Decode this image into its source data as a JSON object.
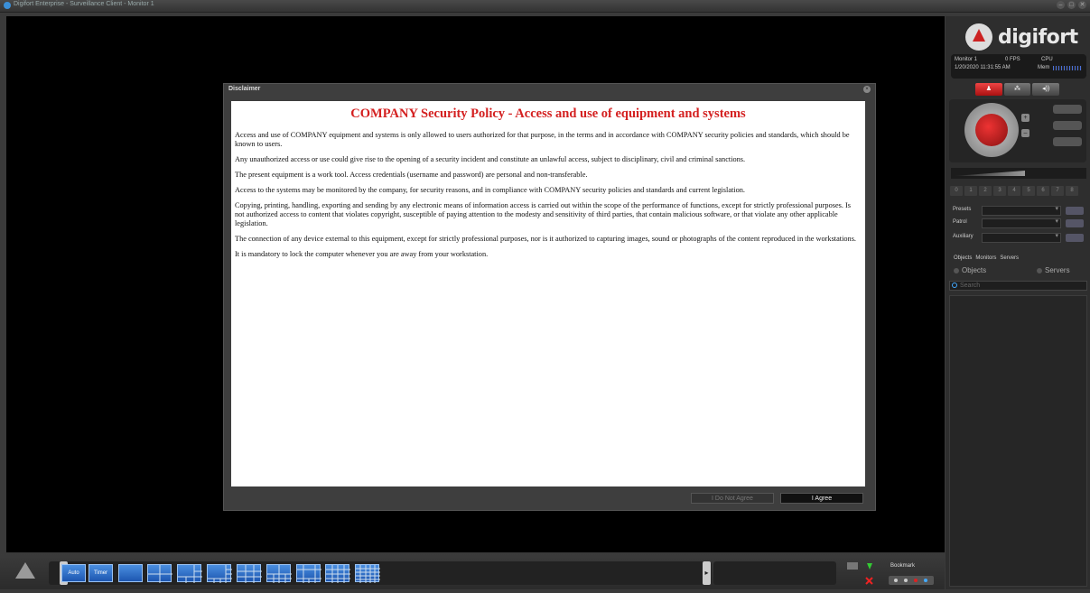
{
  "window": {
    "title": "Digifort Enterprise - Surveillance Client - Monitor 1",
    "controls": [
      "–",
      "□",
      "✕"
    ]
  },
  "right_panel": {
    "logo_text": "digifort",
    "monitor": "Monitor 1",
    "fps": "0 FPS",
    "cpu_label": "CPU",
    "datetime": "1/20/2020 11:31:55 AM",
    "mem_label": "Mem",
    "preset_numbers": [
      "0",
      "1",
      "2",
      "3",
      "4",
      "5",
      "6",
      "7",
      "8"
    ],
    "presets_label": "Presets",
    "patrol_label": "Patrol",
    "auxiliary_label": "Auxiliary",
    "tabs": [
      "Objects",
      "Monitors",
      "Servers"
    ],
    "radio_objects": "Objects",
    "radio_servers": "Servers",
    "search_placeholder": "Search"
  },
  "bottom_bar": {
    "auto_label": "Auto",
    "timer_label": "Timer",
    "bookmark_label": "Bookmark"
  },
  "dialog": {
    "title": "Disclaimer",
    "heading": "COMPANY Security Policy - Access and use of equipment and systems",
    "paragraphs": [
      "Access and use of COMPANY equipment and systems is only allowed to users authorized for that purpose, in the terms and in accordance with COMPANY security policies and standards, which should be known to users.",
      "Any unauthorized access or use could give rise to the opening of a security incident and constitute an unlawful access, subject to disciplinary, civil and criminal sanctions.",
      "The present equipment is a work tool. Access credentials (username and password) are personal and non-transferable.",
      "Access to the systems may be monitored by the company, for security reasons, and in compliance with COMPANY security policies and standards and current legislation.",
      "Copying, printing, handling, exporting and sending by any electronic means of information access is carried out within the scope of the performance of functions, except for strictly professional purposes. Is not authorized access to content that violates copyright, susceptible of paying attention to the modesty and sensitivity of third parties, that contain malicious software, or that violate any other applicable legislation.",
      "The connection of any device external to this equipment, except for strictly professional purposes, nor is it authorized to capturing images, sound or photographs of the content reproduced in the workstations.",
      "It is mandatory to lock the computer whenever you are away from your workstation."
    ],
    "disagree_label": "I Do Not Agree",
    "agree_label": "I Agree",
    "heading_color": "#d42020"
  }
}
